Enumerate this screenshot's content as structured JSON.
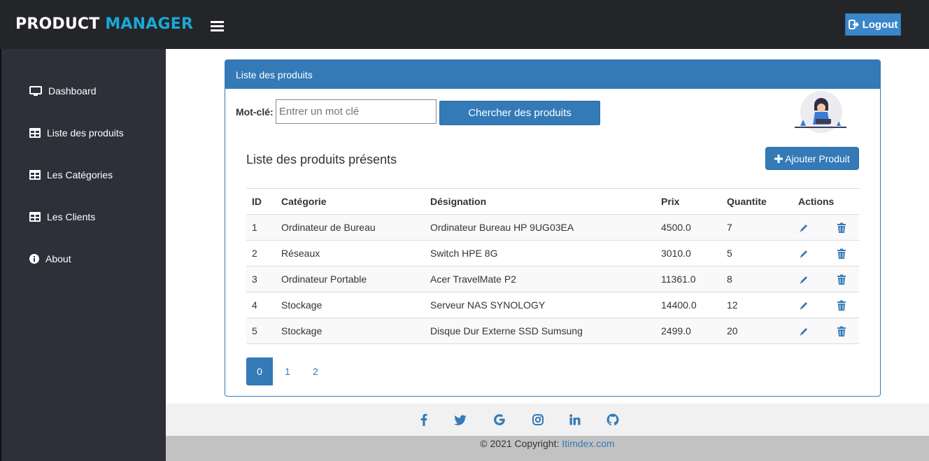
{
  "header": {
    "brand_part1": "PRODUCT",
    "brand_part2": "MANAGER",
    "logout_label": "Logout"
  },
  "sidebar": {
    "items": [
      {
        "label": "Dashboard",
        "icon": "monitor-icon"
      },
      {
        "label": "Liste des produits",
        "icon": "table-icon"
      },
      {
        "label": "Les Catégories",
        "icon": "table-icon"
      },
      {
        "label": "Les Clients",
        "icon": "table-icon"
      },
      {
        "label": "About",
        "icon": "info-icon"
      }
    ]
  },
  "panel": {
    "title": "Liste des produits",
    "keyword_label": "Mot-clé:",
    "keyword_placeholder": "Entrer un mot clé",
    "keyword_value": "",
    "search_button": "Chercher des produits",
    "subtitle": "Liste des produits présents",
    "add_button": "Ajouter Produit"
  },
  "table": {
    "headers": [
      "ID",
      "Catégorie",
      "Désignation",
      "Prix",
      "Quantite",
      "Actions"
    ],
    "rows": [
      {
        "id": "1",
        "categorie": "Ordinateur de Bureau",
        "designation": "Ordinateur Bureau HP 9UG03EA",
        "prix": "4500.0",
        "quantite": "7"
      },
      {
        "id": "2",
        "categorie": "Réseaux",
        "designation": "Switch HPE 8G",
        "prix": "3010.0",
        "quantite": "5"
      },
      {
        "id": "3",
        "categorie": "Ordinateur Portable",
        "designation": "Acer TravelMate P2",
        "prix": "11361.0",
        "quantite": "8"
      },
      {
        "id": "4",
        "categorie": "Stockage",
        "designation": "Serveur NAS SYNOLOGY",
        "prix": "14400.0",
        "quantite": "12"
      },
      {
        "id": "5",
        "categorie": "Stockage",
        "designation": "Disque Dur Externe SSD Sumsung",
        "prix": "2499.0",
        "quantite": "20"
      }
    ]
  },
  "pagination": {
    "pages": [
      "0",
      "1",
      "2"
    ],
    "active": "0"
  },
  "footer": {
    "social_icons": [
      "facebook-icon",
      "twitter-icon",
      "google-icon",
      "instagram-icon",
      "linkedin-icon",
      "github-icon"
    ],
    "copyright_text": "© 2021 Copyright: ",
    "copyright_link": "Itimdex.com"
  },
  "colors": {
    "topbar": "#232529",
    "sidebar": "#2d3039",
    "primary": "#337ab7",
    "brand_accent": "#1aa8d8"
  }
}
